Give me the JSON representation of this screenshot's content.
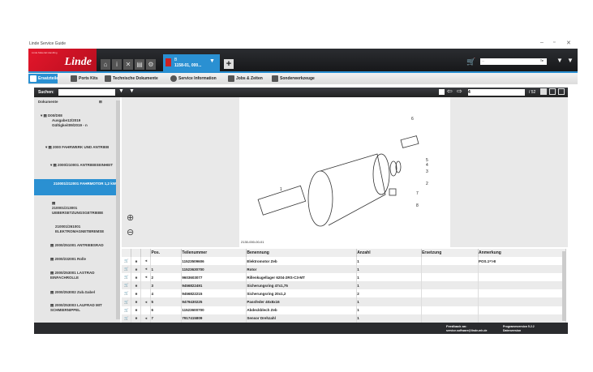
{
  "window": {
    "title": "Linde Service Guide",
    "min": "–",
    "max": "▫",
    "close": "✕"
  },
  "header": {
    "brand": "Linde",
    "brand_sub": "Linde Material Handling",
    "doc_tab": {
      "line1": "B",
      "line2": "1158-01, 000..."
    },
    "search_value": "...",
    "search_scope": "Te"
  },
  "nav": [
    {
      "label": "Ersatzteile"
    },
    {
      "label": "Ports Kits"
    },
    {
      "label": "Technische Dokumente"
    },
    {
      "label": "Service Information"
    },
    {
      "label": "Jobs & Zeiten"
    },
    {
      "label": "Sonderwerkzeuge"
    }
  ],
  "toolbar": {
    "search_label": "Suchen:",
    "page_value": "4",
    "page_total": "/ 52"
  },
  "sidebar": {
    "title": "Dokumente",
    "items": [
      {
        "label": "D00/D08",
        "sub": "Ausgabe12/2019 Gültigkeit09/2019 - n"
      },
      {
        "label": "2000 FAHRWERK UND ANTRIEB"
      },
      {
        "label": "2000/210001 ANTRIEBSEINHEIT"
      },
      {
        "label": "210001/212001 FAHRMOTOR 1,2 kW"
      },
      {
        "label": "210001/213001 UEBERSETZUNGSGETRIEBE"
      },
      {
        "label": "210001/261001 ELEKTROMAGNETBREMSE"
      },
      {
        "label": "2000/251001 ANTRIEBSRAD"
      },
      {
        "label": "2000/232001 Rolle"
      },
      {
        "label": "2000/253001 LASTRAD EINFACHROLLE"
      },
      {
        "label": "2000/253002 Zub.Gabel"
      },
      {
        "label": "2000/253003 LAUFRAD MIT SCHMIERNIPPEL"
      }
    ]
  },
  "drawing": {
    "caption": "2130-000-00-01",
    "labels": [
      "1",
      "2",
      "3",
      "4",
      "5",
      "6",
      "7",
      "8"
    ]
  },
  "table": {
    "headers": [
      "",
      "",
      "",
      "Pos.",
      "Teilenummer",
      "Benennung",
      "Anzahl",
      "Ersetzung",
      "Anmerkung"
    ],
    "rows": [
      {
        "pos": "",
        "nr": "11523509606",
        "name": "Elektromotor Zeb",
        "qty": "1",
        "repl": "",
        "note": "POS.1=>8",
        "info": true
      },
      {
        "pos": "1",
        "nr": "11523630700",
        "name": "Rotor",
        "qty": "1",
        "repl": "",
        "note": "",
        "info": true
      },
      {
        "pos": "2",
        "nr": "9603603077",
        "name": "Rillenkugellager 6204-2RS-C3-MT",
        "qty": "1",
        "repl": "",
        "note": "",
        "info": true
      },
      {
        "pos": "3",
        "nr": "9456822491",
        "name": "Sicherungsring 47x1,75",
        "qty": "1",
        "repl": "",
        "note": "",
        "info": false
      },
      {
        "pos": "4",
        "nr": "9456822215",
        "name": "Sicherungsring 20x1,2",
        "qty": "2",
        "repl": "",
        "note": "",
        "info": false
      },
      {
        "pos": "5",
        "nr": "9479430225",
        "name": "Passfeder 40x8x16",
        "qty": "1",
        "repl": "",
        "note": "",
        "info": true
      },
      {
        "pos": "6",
        "nr": "11523600700",
        "name": "Abdeckblech Zeb",
        "qty": "1",
        "repl": "",
        "note": "",
        "info": false
      },
      {
        "pos": "7",
        "nr": "7917415809",
        "name": "Sensor Drehzahl",
        "qty": "1",
        "repl": "",
        "note": "",
        "info": true
      }
    ]
  },
  "footer": {
    "feedback_label": "Feedback an:",
    "feedback_email": "service.software@linde-mh.de",
    "program_version": "Programmversion 5.2.2",
    "data_version": "Datenversion"
  }
}
